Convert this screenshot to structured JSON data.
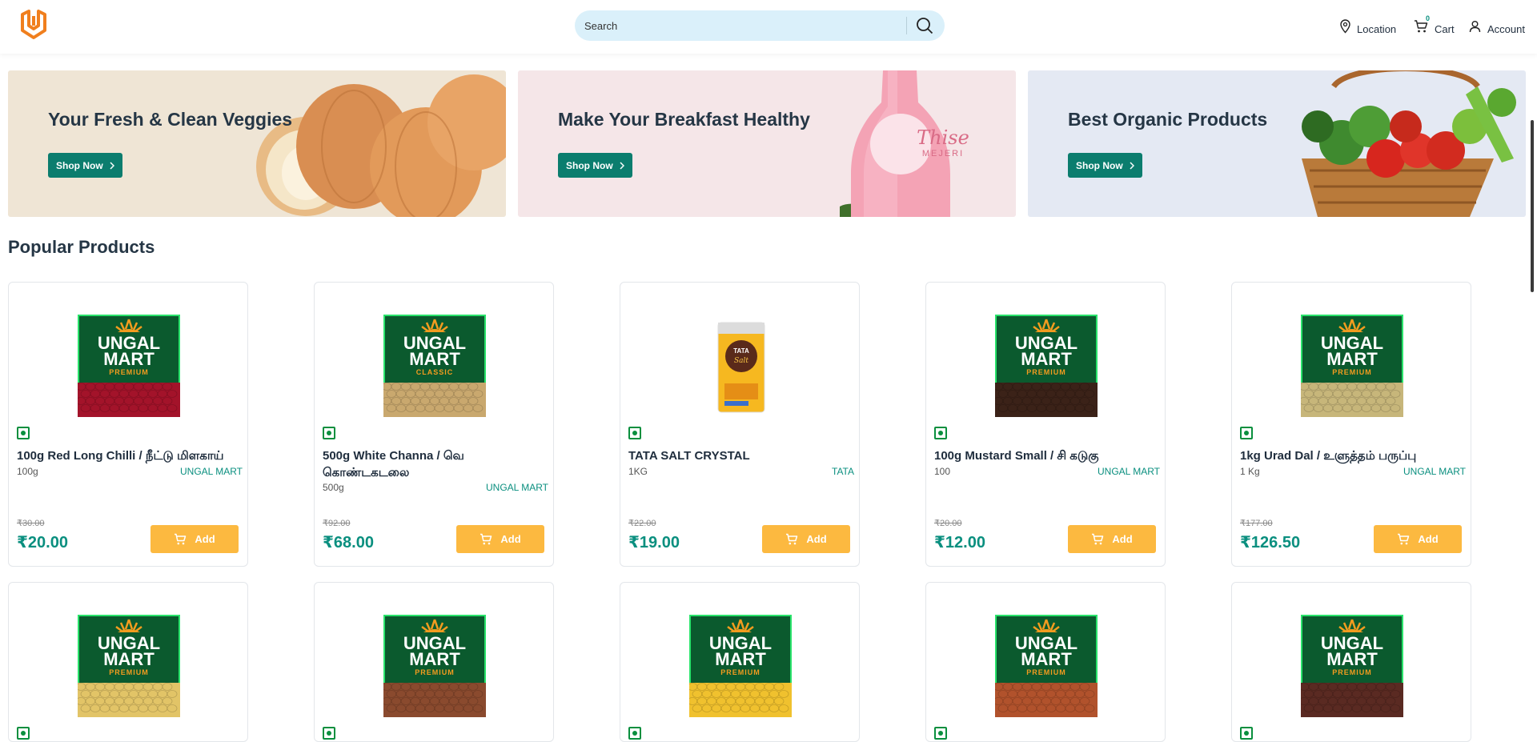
{
  "header": {
    "search_placeholder": "Search",
    "location_label": "Location",
    "cart_label": "Cart",
    "cart_count": "0",
    "account_label": "Account"
  },
  "banners": [
    {
      "title": "Your Fresh & Clean Veggies",
      "button": "Shop Now",
      "bg": "#efe5d5"
    },
    {
      "title": "Make Your Breakfast Healthy",
      "button": "Shop Now",
      "bg": "#f5e6e8"
    },
    {
      "title": "Best Organic Products",
      "button": "Shop Now",
      "bg": "#e4e9f3"
    }
  ],
  "bottle_text": {
    "brand": "Thise",
    "sub": "MEJERI"
  },
  "section_title": "Popular Products",
  "products": [
    {
      "name": "100g Red Long Chilli / நீட்டு மிளகாய்",
      "qty": "100g",
      "brand": "UNGAL MART",
      "old_price": "₹30.00",
      "price": "₹20.00",
      "add": "Add",
      "pack_top": "UNGAL",
      "pack_mid": "MART",
      "pack_tag": "PREMIUM"
    },
    {
      "name": "500g White Channa / வெ கொண்டகடலை",
      "qty": "500g",
      "brand": "UNGAL MART",
      "old_price": "₹92.00",
      "price": "₹68.00",
      "add": "Add",
      "pack_top": "UNGAL",
      "pack_mid": "MART",
      "pack_tag": "CLASSIC"
    },
    {
      "name": "TATA SALT CRYSTAL",
      "qty": "1KG",
      "brand": "TATA",
      "old_price": "₹22.00",
      "price": "₹19.00",
      "add": "Add",
      "pack_top": "TATA",
      "pack_mid": "Salt",
      "pack_tag": ""
    },
    {
      "name": "100g Mustard Small / சி கடுகு",
      "qty": "100",
      "brand": "UNGAL MART",
      "old_price": "₹20.00",
      "price": "₹12.00",
      "add": "Add",
      "pack_top": "UNGAL",
      "pack_mid": "MART",
      "pack_tag": "PREMIUM"
    },
    {
      "name": "1kg Urad Dal / உளுத்தம் பருப்பு",
      "qty": "1 Kg",
      "brand": "UNGAL MART",
      "old_price": "₹177.00",
      "price": "₹126.50",
      "add": "Add",
      "pack_top": "UNGAL",
      "pack_mid": "MART",
      "pack_tag": "PREMIUM"
    }
  ],
  "row2_packs": [
    {
      "pack_top": "UNGAL",
      "pack_mid": "MART",
      "pack_tag": "PREMIUM"
    },
    {
      "pack_top": "UNGAL",
      "pack_mid": "MART",
      "pack_tag": "PREMIUM"
    },
    {
      "pack_top": "UNGAL",
      "pack_mid": "MART",
      "pack_tag": "PREMIUM"
    },
    {
      "pack_top": "UNGAL",
      "pack_mid": "MART",
      "pack_tag": "PREMIUM"
    },
    {
      "pack_top": "UNGAL",
      "pack_mid": "MART",
      "pack_tag": "PREMIUM"
    }
  ],
  "colors": {
    "accent": "#0a8f7f",
    "button_dark": "#0b7d6e",
    "add_button": "#fcb940",
    "logo": "#f07f1e",
    "search_bg": "#daf0fa"
  }
}
